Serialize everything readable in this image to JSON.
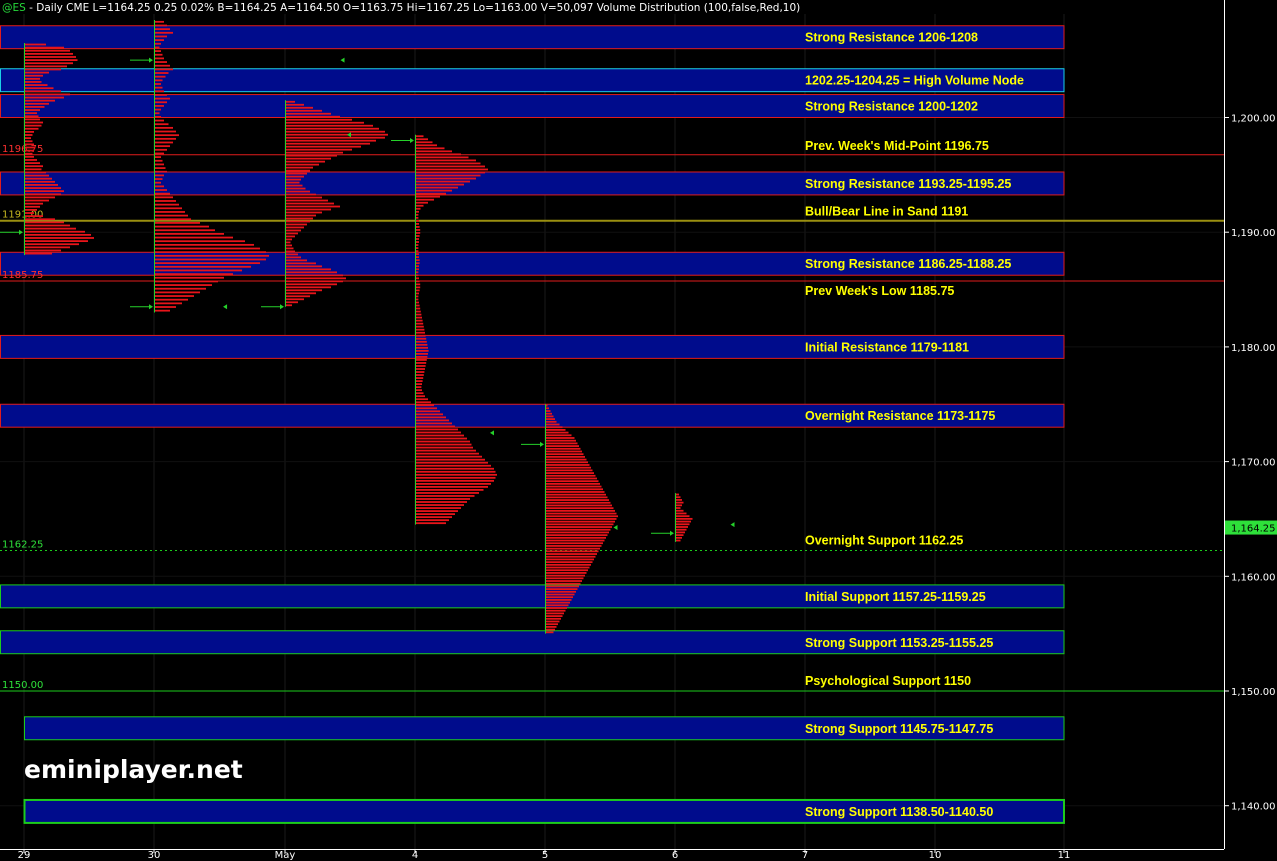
{
  "header": {
    "symbol": "@ES",
    "text": " - Daily  CME  L=1164.25  0.25  0.02%  B=1164.25  A=1164.50  O=1163.75  Hi=1167.25  Lo=1163.00  V=50,097  Volume Distribution (100,false,Red,10)"
  },
  "watermark": "eminiplayer.net",
  "current_price": {
    "label": "1,164.25",
    "value": 1164.25
  },
  "colors": {
    "background": "#000000",
    "zone_fill": "#000c8c",
    "resistance_border": "#e01c1c",
    "support_border": "#1ccc1c",
    "hvn_border": "#1ad1e8",
    "label_text": "#ffff00",
    "profile_bar": "#e8141a",
    "profile_axis": "#25d12a",
    "bull_bear_line": "#9a8f10"
  },
  "chart_data": {
    "type": "volume_profile_with_levels",
    "ylim": [
      1135.5,
      1210
    ],
    "y_ticks": [
      {
        "value": 1140,
        "label": "1,140.00"
      },
      {
        "value": 1150,
        "label": "1,150.00"
      },
      {
        "value": 1160,
        "label": "1,160.00"
      },
      {
        "value": 1170,
        "label": "1,170.00"
      },
      {
        "value": 1180,
        "label": "1,180.00"
      },
      {
        "value": 1190,
        "label": "1,190.00"
      },
      {
        "value": 1200,
        "label": "1,200.00"
      }
    ],
    "x_ticks": [
      "29",
      "30",
      "May",
      "4",
      "5",
      "6",
      "7",
      "10",
      "11"
    ],
    "zones": [
      {
        "lo": 1206,
        "hi": 1208,
        "label": "Strong Resistance 1206-1208",
        "kind": "resistance",
        "full": true
      },
      {
        "lo": 1202.25,
        "hi": 1204.25,
        "label": "1202.25-1204.25 = High Volume Node",
        "kind": "hvn",
        "full": true
      },
      {
        "lo": 1200,
        "hi": 1202,
        "label": "Strong Resistance 1200-1202",
        "kind": "resistance",
        "full": true
      },
      {
        "lo": 1193.25,
        "hi": 1195.25,
        "label": "Strong Resistance 1193.25-1195.25",
        "kind": "resistance",
        "full": true
      },
      {
        "lo": 1186.25,
        "hi": 1188.25,
        "label": "Strong Resistance 1186.25-1188.25",
        "kind": "resistance",
        "full": true
      },
      {
        "lo": 1179,
        "hi": 1181,
        "label": "Initial Resistance 1179-1181",
        "kind": "resistance",
        "full": true
      },
      {
        "lo": 1173,
        "hi": 1175,
        "label": "Overnight Resistance 1173-1175",
        "kind": "resistance",
        "full": true
      },
      {
        "lo": 1157.25,
        "hi": 1159.25,
        "label": "Initial Support 1157.25-1159.25",
        "kind": "support",
        "full": true
      },
      {
        "lo": 1153.25,
        "hi": 1155.25,
        "label": "Strong Support 1153.25-1155.25",
        "kind": "support",
        "full": true
      },
      {
        "lo": 1145.75,
        "hi": 1147.75,
        "label": "Strong Support 1145.75-1147.75",
        "kind": "support",
        "full": false
      },
      {
        "lo": 1138.5,
        "hi": 1140.5,
        "label": "Strong Support 1138.50-1140.50",
        "kind": "support_bright",
        "full": false
      }
    ],
    "lines": [
      {
        "value": 1196.75,
        "label": "Prev. Week's Mid-Point 1196.75",
        "tag": "1196.75",
        "kind": "resistance"
      },
      {
        "value": 1191,
        "label": "Bull/Bear Line in Sand 1191",
        "tag": "1191.00",
        "kind": "bullbear"
      },
      {
        "value": 1185.75,
        "label": "Prev Week's Low 1185.75",
        "tag": "1185.75",
        "kind": "resistance"
      },
      {
        "value": 1162.25,
        "label": "Overnight Support 1162.25",
        "tag": "1162.25",
        "kind": "dashed"
      },
      {
        "value": 1150,
        "label": "Psychological Support 1150",
        "tag": "1150.00",
        "kind": "support"
      }
    ],
    "sessions": [
      {
        "day": "29",
        "lo": 1188,
        "hi": 1206.5,
        "open": 1190,
        "close": 1205,
        "volumes": [
          70,
          130,
          150,
          160,
          170,
          175,
          160,
          140,
          120,
          80,
          60,
          50,
          55,
          75,
          95,
          120,
          150,
          130,
          100,
          80,
          65,
          50,
          40,
          45,
          50,
          60,
          55,
          45,
          30,
          25,
          20,
          25,
          30,
          35,
          30,
          25,
          30,
          40,
          50,
          60,
          55,
          70,
          80,
          90,
          100,
          110,
          120,
          130,
          120,
          100,
          80,
          60,
          50,
          40,
          30,
          60,
          100,
          130,
          150,
          170,
          200,
          220,
          230,
          210,
          180,
          150,
          120,
          90
        ]
      },
      {
        "day": "30",
        "lo": 1183,
        "hi": 1208.5,
        "open": 1208,
        "close": 1183.5,
        "volumes": [
          30,
          40,
          50,
          60,
          40,
          30,
          20,
          15,
          20,
          25,
          30,
          40,
          50,
          60,
          45,
          35,
          25,
          20,
          25,
          30,
          40,
          50,
          40,
          30,
          20,
          15,
          20,
          30,
          45,
          60,
          70,
          80,
          70,
          60,
          50,
          40,
          30,
          20,
          25,
          30,
          35,
          40,
          30,
          25,
          20,
          30,
          40,
          50,
          60,
          70,
          80,
          90,
          100,
          110,
          120,
          150,
          180,
          200,
          230,
          260,
          300,
          330,
          350,
          370,
          380,
          370,
          350,
          320,
          290,
          260,
          230,
          210,
          190,
          170,
          150,
          130,
          110,
          90,
          70,
          50
        ]
      },
      {
        "day": "May",
        "lo": 1183.5,
        "hi": 1201.5,
        "open": 1183.5,
        "close": 1183.5,
        "volumes": [
          30,
          60,
          90,
          120,
          150,
          180,
          220,
          260,
          290,
          310,
          330,
          340,
          330,
          300,
          280,
          250,
          220,
          190,
          170,
          150,
          130,
          110,
          90,
          80,
          70,
          60,
          50,
          45,
          55,
          65,
          80,
          100,
          120,
          140,
          160,
          180,
          150,
          120,
          100,
          90,
          80,
          70,
          60,
          50,
          40,
          30,
          20,
          15,
          20,
          25,
          30,
          40,
          50,
          70,
          100,
          120,
          150,
          170,
          190,
          200,
          190,
          170,
          150,
          120,
          100,
          80,
          60,
          40,
          20
        ]
      },
      {
        "day": "4",
        "lo": 1164.5,
        "hi": 1198.5,
        "open": 1197.5,
        "close": 1173.5,
        "volumes": [
          25,
          40,
          55,
          70,
          95,
          120,
          150,
          175,
          200,
          215,
          230,
          240,
          230,
          215,
          200,
          180,
          160,
          140,
          120,
          100,
          80,
          60,
          40,
          25,
          15,
          10,
          8,
          8,
          10,
          10,
          12,
          14,
          14,
          12,
          10,
          10,
          8,
          8,
          8,
          10,
          10,
          12,
          12,
          10,
          10,
          8,
          8,
          10,
          12,
          14,
          14,
          12,
          10,
          8,
          8,
          10,
          12,
          14,
          16,
          18,
          20,
          22,
          24,
          26,
          28,
          30,
          32,
          34,
          36,
          38,
          40,
          42,
          40,
          38,
          36,
          34,
          32,
          30,
          28,
          26,
          24,
          22,
          20,
          18,
          20,
          25,
          30,
          40,
          50,
          60,
          70,
          80,
          90,
          100,
          110,
          120,
          130,
          140,
          150,
          160,
          170,
          180,
          185,
          190,
          200,
          210,
          220,
          230,
          240,
          250,
          260,
          265,
          270,
          265,
          260,
          250,
          240,
          225,
          210,
          195,
          180,
          170,
          160,
          150,
          140,
          130,
          120,
          110,
          100
        ]
      },
      {
        "day": "5",
        "lo": 1155,
        "hi": 1175,
        "open": 1163.5,
        "close": 1164.5,
        "volumes": [
          5,
          10,
          15,
          20,
          25,
          30,
          35,
          45,
          55,
          65,
          75,
          85,
          95,
          100,
          105,
          110,
          115,
          120,
          125,
          130,
          135,
          140,
          145,
          150,
          155,
          160,
          165,
          170,
          175,
          180,
          185,
          190,
          195,
          200,
          205,
          210,
          215,
          220,
          225,
          230,
          235,
          240,
          235,
          230,
          225,
          220,
          215,
          210,
          205,
          200,
          195,
          190,
          185,
          180,
          175,
          170,
          165,
          160,
          155,
          150,
          145,
          140,
          135,
          130,
          125,
          120,
          115,
          110,
          105,
          100,
          95,
          90,
          85,
          80,
          75,
          70,
          65,
          60,
          55,
          50,
          45,
          40,
          35,
          30,
          25
        ]
      },
      {
        "day": "6",
        "lo": 1163,
        "hi": 1167.25,
        "open": 1163.75,
        "close": 1164.25,
        "volumes": [
          10,
          15,
          20,
          25,
          20,
          15,
          25,
          35,
          45,
          55,
          50,
          45,
          40,
          35,
          30,
          25,
          20,
          15
        ]
      }
    ],
    "markers": [
      {
        "type": "arrow",
        "day": "29",
        "value": 1190.0
      },
      {
        "type": "arrow",
        "day": "30",
        "value": 1205.0
      },
      {
        "type": "arrow",
        "day": "30",
        "value": 1183.5
      },
      {
        "type": "arrow",
        "day": "May",
        "value": 1183.5
      },
      {
        "type": "arrow",
        "day": "4",
        "value": 1198.0
      },
      {
        "type": "arrow",
        "day": "5",
        "value": 1171.5
      },
      {
        "type": "arrow",
        "day": "6",
        "value": 1163.75
      },
      {
        "type": "tick",
        "day_pos": 2.45,
        "value": 1205.0
      },
      {
        "type": "tick",
        "day_pos": 1.55,
        "value": 1183.5
      },
      {
        "type": "tick",
        "day_pos": 2.5,
        "value": 1198.5
      },
      {
        "type": "tick",
        "day_pos": 3.6,
        "value": 1172.5
      },
      {
        "type": "tick",
        "day_pos": 4.55,
        "value": 1164.25
      },
      {
        "type": "tick",
        "day_pos": 5.45,
        "value": 1164.5
      }
    ]
  }
}
